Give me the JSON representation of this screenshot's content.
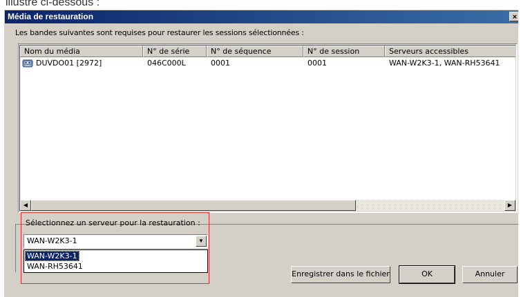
{
  "doc_fragment": "illustré ci-dessous :",
  "dialog": {
    "title": "Média de restauration",
    "close_label": "×",
    "instruction": "Les bandes suivantes sont requises pour restaurer les sessions sélectionnées :"
  },
  "table": {
    "columns": [
      "Nom du média",
      "N° de série",
      "N° de séquence",
      "N° de session",
      "Serveurs accessibles"
    ],
    "rows": [
      {
        "icon": "tape-icon",
        "cells": [
          "DUVDO01 [2972]",
          "046C000L",
          "0001",
          "0001",
          "WAN-W2K3-1, WAN-RH53641"
        ]
      }
    ]
  },
  "server_select": {
    "label": "Sélectionnez un serveur pour la restauration :",
    "value": "WAN-W2K3-1",
    "options": [
      "WAN-W2K3-1",
      "WAN-RH53641"
    ],
    "selected_index": 0
  },
  "buttons": {
    "save": "Enregistrer dans le fichier",
    "ok": "OK",
    "cancel": "Annuler"
  },
  "colors": {
    "titlebar": "#0a246a",
    "highlight_box": "#e03030",
    "dialog_bg": "#d4d0c8"
  }
}
